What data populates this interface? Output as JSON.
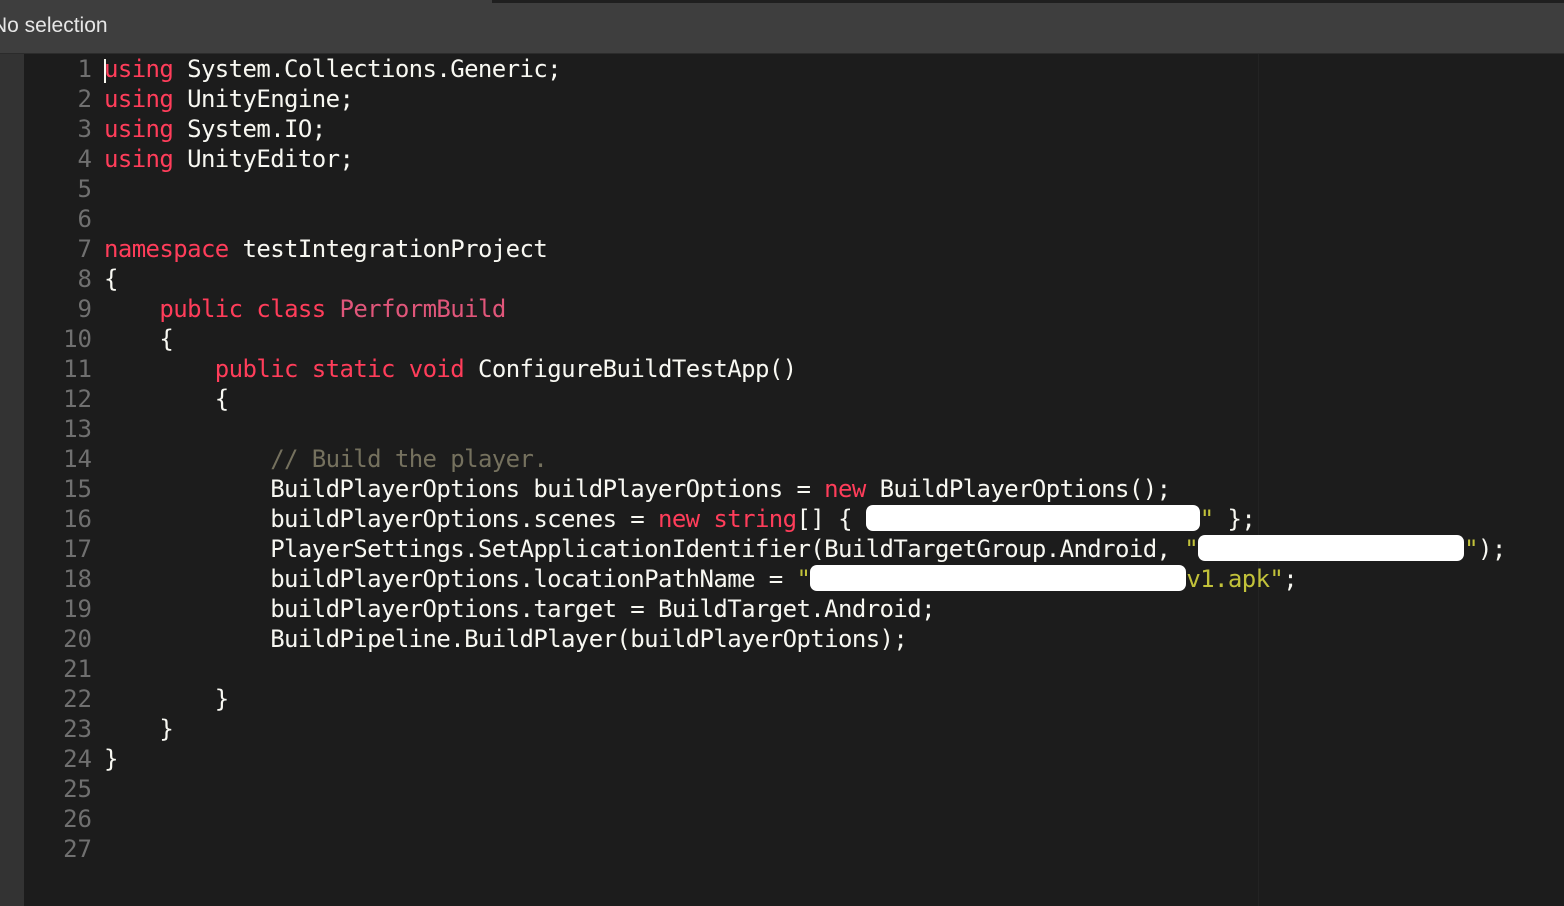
{
  "title_bar": {
    "status": "No selection"
  },
  "editor": {
    "line_numbers": [
      "1",
      "2",
      "3",
      "4",
      "5",
      "6",
      "7",
      "8",
      "9",
      "10",
      "11",
      "12",
      "13",
      "14",
      "15",
      "16",
      "17",
      "18",
      "19",
      "20",
      "21",
      "22",
      "23",
      "24",
      "25",
      "26",
      "27"
    ],
    "code": {
      "l1_kw": "using",
      "l1_rest": " System.Collections.Generic;",
      "l2_kw": "using",
      "l2_rest": " UnityEngine;",
      "l3_kw": "using",
      "l3_rest": " System.IO;",
      "l4_kw": "using",
      "l4_rest": " UnityEditor;",
      "l7_kw": "namespace",
      "l7_rest": " testIntegrationProject",
      "l8": "{",
      "l9_indent": "    ",
      "l9_kw1": "public",
      "l9_kw2": "class",
      "l9_type": "PerformBuild",
      "l10": "    {",
      "l11_indent": "        ",
      "l11_kw1": "public",
      "l11_kw2": "static",
      "l11_kw3": "void",
      "l11_rest": " ConfigureBuildTestApp()",
      "l12": "        {",
      "l14_indent": "            ",
      "l14_comment": "// Build the player.",
      "l15_a": "            BuildPlayerOptions buildPlayerOptions = ",
      "l15_kw": "new",
      "l15_b": " BuildPlayerOptions();",
      "l16_a": "            buildPlayerOptions.scenes = ",
      "l16_kw1": "new",
      "l16_kw2": "string",
      "l16_b": "[] { ",
      "l16_str_close": "\"",
      "l16_c": " };",
      "l17_a": "            PlayerSettings.SetApplicationIdentifier(BuildTargetGroup.Android, ",
      "l17_str_open": "\"",
      "l17_str_close": "\"",
      "l17_b": ");",
      "l18_a": "            buildPlayerOptions.locationPathName = ",
      "l18_str_open": "\"",
      "l18_str_tail": "v1.apk\"",
      "l18_b": ";",
      "l19": "            buildPlayerOptions.target = BuildTarget.Android;",
      "l20": "            BuildPipeline.BuildPlayer(buildPlayerOptions);",
      "l22": "        }",
      "l23": "    }",
      "l24": "}"
    }
  },
  "colors": {
    "background": "#1c1c1c",
    "keyword": "#f92672",
    "type_name": "#e0567a",
    "comment": "#75715e",
    "string": "#c2c23a",
    "text": "#f8f8f2",
    "line_number": "#707070",
    "title_bar": "#3e3e3e"
  }
}
